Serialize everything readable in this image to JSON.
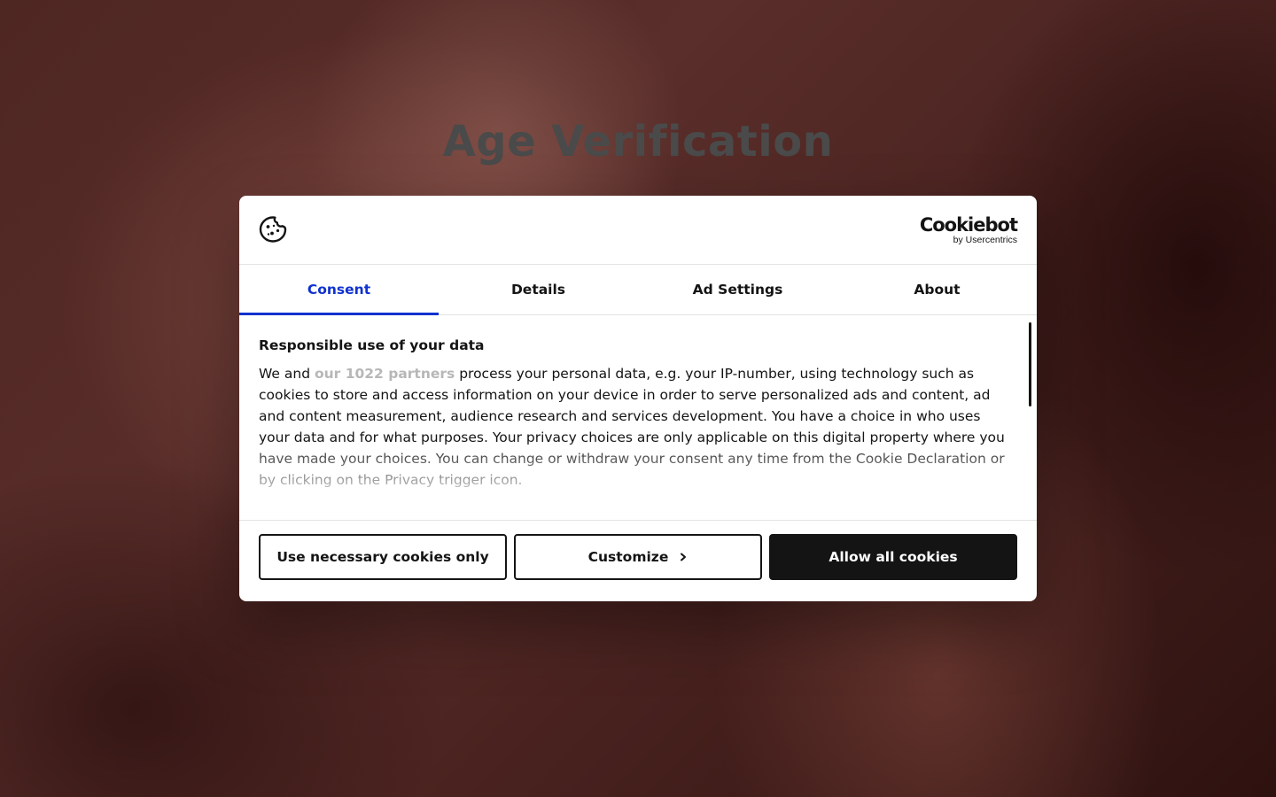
{
  "page": {
    "title": "Age Verification"
  },
  "dialog": {
    "brand": {
      "name": "Cookiebot",
      "sub": "by Usercentrics"
    },
    "tabs": [
      {
        "label": "Consent",
        "active": true
      },
      {
        "label": "Details",
        "active": false
      },
      {
        "label": "Ad Settings",
        "active": false
      },
      {
        "label": "About",
        "active": false
      }
    ],
    "content": {
      "heading": "Responsible use of your data",
      "text_before_link": "We and ",
      "partners_link": "our 1022 partners",
      "text_after_link": " process your personal data, e.g. your IP-number, using technology such as cookies to store and access information on your device in order to serve personalized ads and content, ad and content measurement, audience research and services development. You have a choice in who uses your data and for what purposes. Your privacy choices are only applicable on this digital property where you have made your choices. You can change or withdraw your consent any time from the Cookie Declaration or by clicking on the Privacy trigger icon."
    },
    "buttons": {
      "necessary": "Use necessary cookies only",
      "customize": "Customize",
      "allow_all": "Allow all cookies"
    },
    "icons": {
      "cookie": "cookie-icon",
      "customize_chevron": "chevron-right-icon"
    }
  },
  "colors": {
    "accent": "#1032cf",
    "primary_button": "#141414",
    "link": "#b7b7b7"
  }
}
